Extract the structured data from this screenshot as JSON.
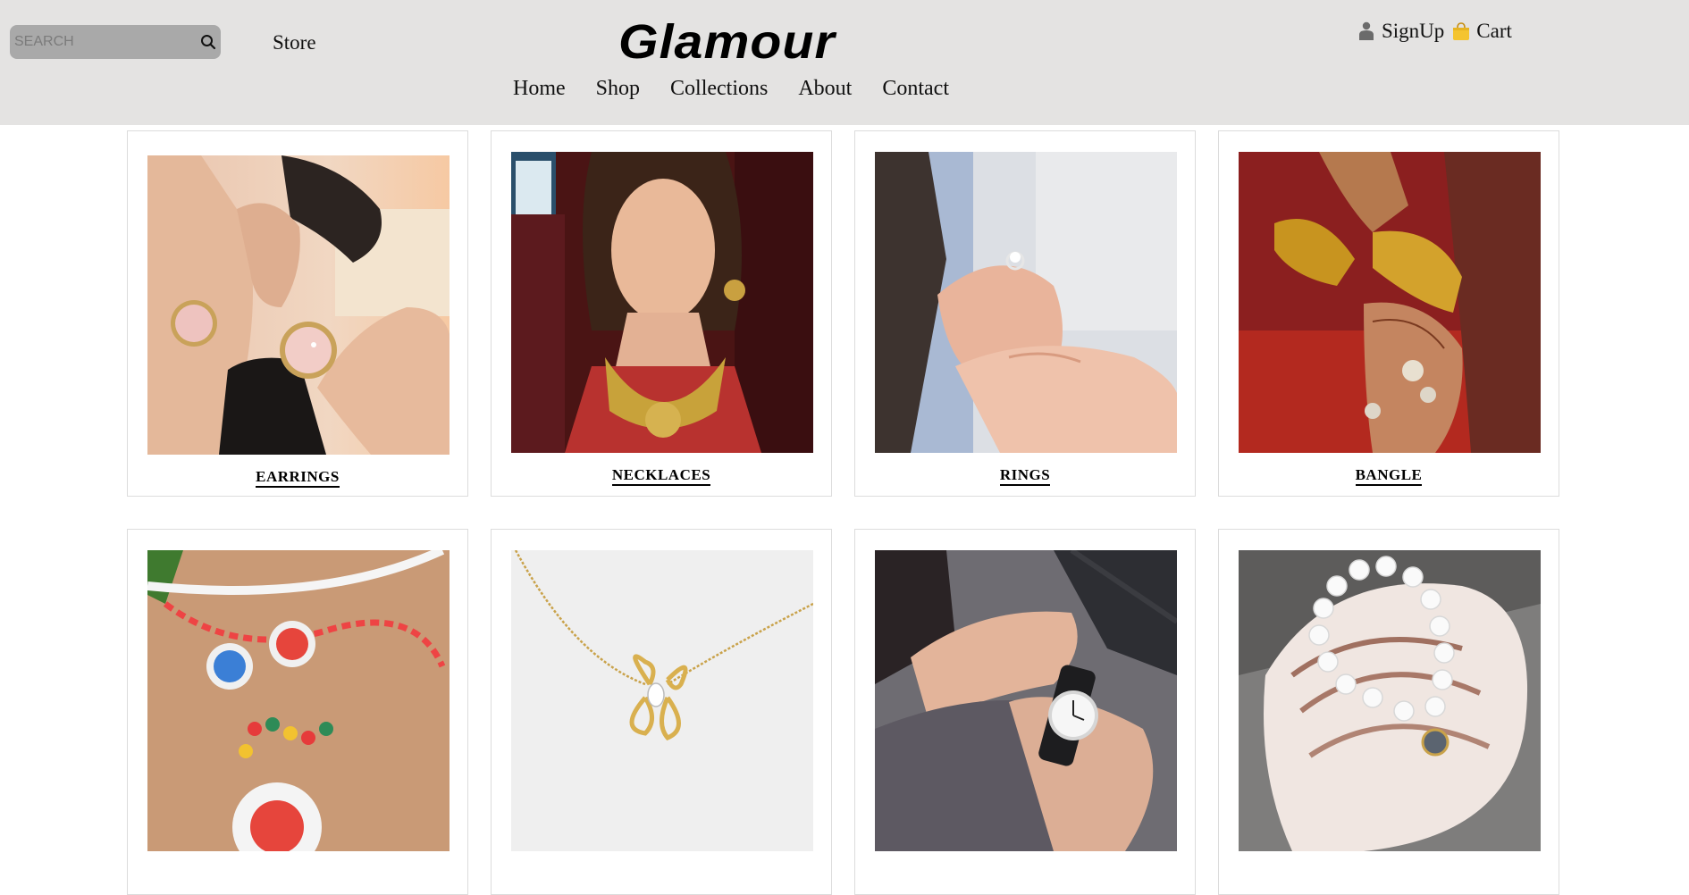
{
  "header": {
    "search_placeholder": "SEARCH",
    "store_label": "Store",
    "logo_text": "Glamour",
    "nav": [
      "Home",
      "Shop",
      "Collections",
      "About",
      "Contact"
    ],
    "signup_label": "SignUp",
    "cart_label": "Cart"
  },
  "categories": [
    {
      "label": "EARRINGS"
    },
    {
      "label": "NECKLACES"
    },
    {
      "label": "RINGS"
    },
    {
      "label": "BANGLE"
    },
    {
      "label": ""
    },
    {
      "label": ""
    },
    {
      "label": ""
    },
    {
      "label": ""
    }
  ],
  "colors": {
    "header_bg": "#e4e3e2",
    "search_bg": "#a9a9a9",
    "card_border": "#dcdcdc"
  }
}
